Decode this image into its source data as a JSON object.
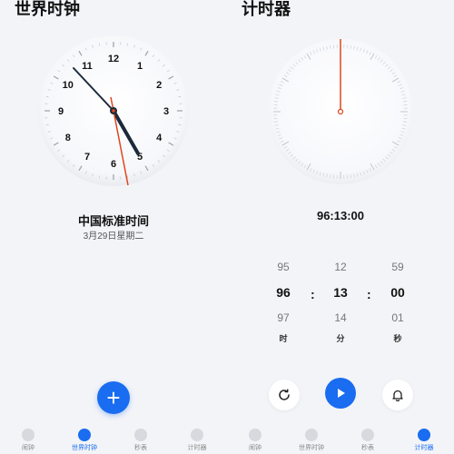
{
  "world_clock": {
    "title": "世界时钟",
    "numerals": [
      "12",
      "1",
      "2",
      "3",
      "4",
      "5",
      "6",
      "7",
      "8",
      "9",
      "10",
      "11"
    ],
    "city": "中国标准时间",
    "date": "3月29日星期二"
  },
  "timer": {
    "title": "计时器",
    "readout": "96:13:00",
    "picker": {
      "hours": {
        "prev": "95",
        "current": "96",
        "next": "97",
        "unit": "时"
      },
      "minutes": {
        "prev": "12",
        "current": "13",
        "next": "14",
        "unit": "分"
      },
      "seconds": {
        "prev": "59",
        "current": "00",
        "next": "01",
        "unit": "秒"
      }
    }
  },
  "fab": {
    "label": "+"
  },
  "tabs": [
    {
      "label": "闹钟",
      "icon": "alarm-icon"
    },
    {
      "label": "世界时钟",
      "icon": "globe-icon"
    },
    {
      "label": "秒表",
      "icon": "stopwatch-icon"
    },
    {
      "label": "计时器",
      "icon": "timer-icon"
    }
  ],
  "colors": {
    "accent": "#1a6cf0",
    "second_hand": "#e0461c"
  }
}
